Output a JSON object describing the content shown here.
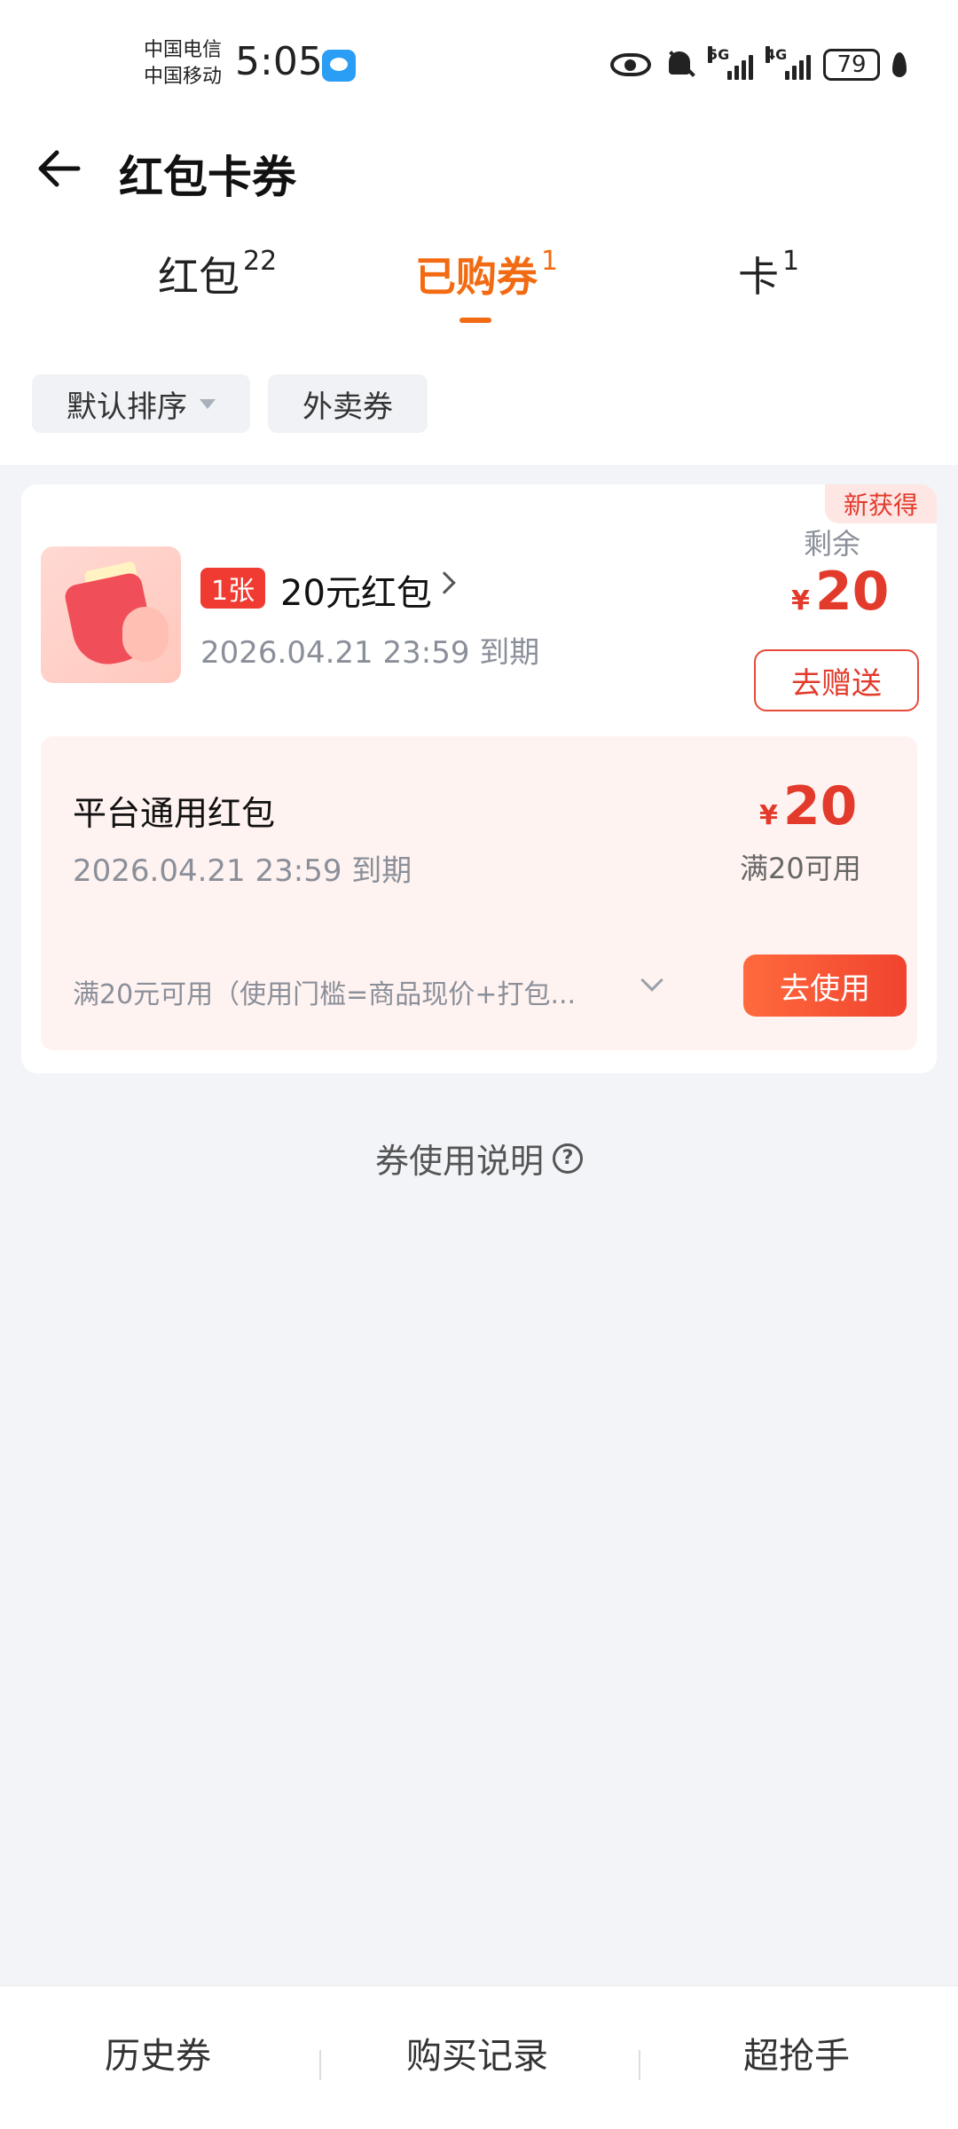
{
  "status_bar": {
    "carrier_1": "中国电信",
    "carrier_2": "中国移动",
    "time": "5:05",
    "network_1": "5G",
    "network_2": "4G",
    "battery": "79"
  },
  "header": {
    "title": "红包卡券"
  },
  "tabs": [
    {
      "label": "红包",
      "count": "22",
      "active": false
    },
    {
      "label": "已购券",
      "count": "1",
      "active": true
    },
    {
      "label": "卡",
      "count": "1",
      "active": false
    }
  ],
  "filters": {
    "sort_label": "默认排序",
    "category_label": "外卖券"
  },
  "coupon": {
    "new_badge": "新获得",
    "count_badge": "1张",
    "name": "20元红包",
    "expire": "2026.04.21 23:59 到期",
    "remain_label": "剩余",
    "currency": "¥",
    "remain_amount": "20",
    "gift_button": "去赠送",
    "detail": {
      "title": "平台通用红包",
      "expire": "2026.04.21 23:59 到期",
      "currency": "¥",
      "amount": "20",
      "condition": "满20可用",
      "rule": "满20元可用（使用门槛=商品现价+打包...",
      "use_button": "去使用"
    }
  },
  "help": {
    "label": "券使用说明"
  },
  "bottom_bar": {
    "history": "历史券",
    "purchases": "购买记录",
    "super_grabber": "超抢手"
  },
  "colors": {
    "accent": "#f26b12",
    "red": "#e23b2c",
    "background": "#f2f4f8"
  }
}
